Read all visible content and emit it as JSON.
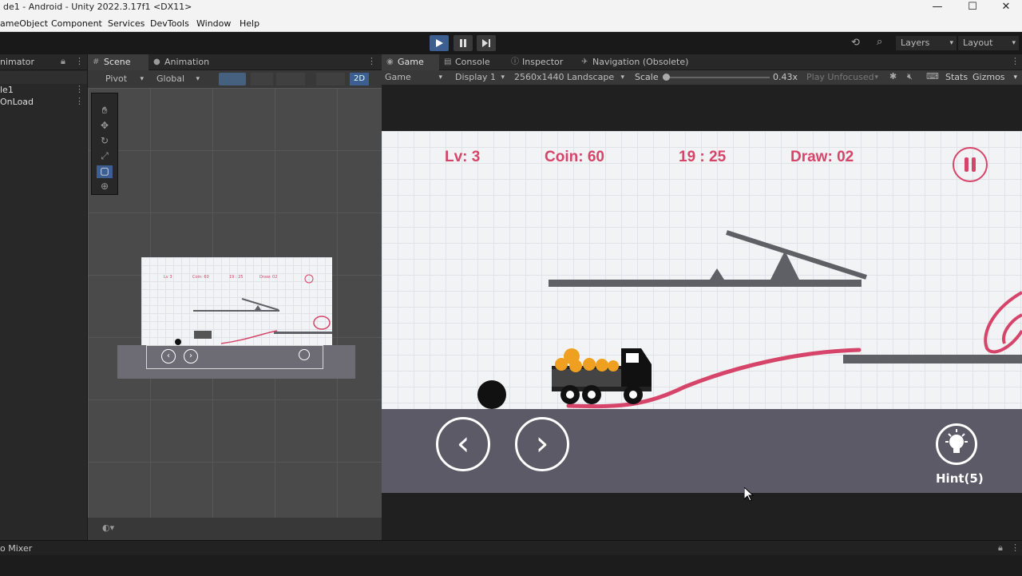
{
  "window": {
    "title": "de1 - Android - Unity 2022.3.17f1 <DX11>",
    "minimize": "—",
    "maximize": "☐",
    "close": "✕"
  },
  "menu": [
    "ameObject",
    "Component",
    "Services",
    "DevTools",
    "Window",
    "Help"
  ],
  "toolbar": {
    "layers_label": "Layers",
    "layout_label": "Layout"
  },
  "hierarchy": {
    "tab_label": "nimator",
    "items": [
      "le1",
      "OnLoad"
    ]
  },
  "scene_tabs": [
    "Scene",
    "Animation"
  ],
  "scene_toolbar": {
    "pivot": "Pivot",
    "global": "Global",
    "mode_2d": "2D"
  },
  "scene_preview_hud": [
    "Lv 3",
    "Coin: 60",
    "19 : 25",
    "Draw: 02"
  ],
  "game_tabs": [
    "Game",
    "Console",
    "Inspector",
    "Navigation (Obsolete)"
  ],
  "game_toolbar": {
    "view": "Game",
    "display": "Display 1",
    "resolution": "2560x1440 Landscape",
    "scale_label": "Scale",
    "scale_value": "0.43x",
    "play_mode": "Play Unfocused",
    "stats": "Stats",
    "gizmos": "Gizmos"
  },
  "game_hud": {
    "level": "Lv: 3",
    "coin": "Coin: 60",
    "time": "19 : 25",
    "draw": "Draw: 02",
    "hint": "Hint(5)"
  },
  "colors": {
    "accent_pink": "#d6446a",
    "ground": "#5b5a66",
    "platform": "#5f5f66"
  },
  "bottom": {
    "mixer_tab": "o Mixer"
  }
}
